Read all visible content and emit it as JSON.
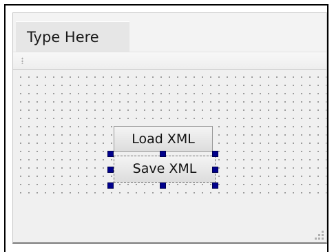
{
  "menubar": {
    "type_here_label": "Type Here"
  },
  "canvas": {
    "buttons": [
      {
        "label": "Load XML",
        "selected": false
      },
      {
        "label": "Save XML",
        "selected": true
      }
    ]
  },
  "colors": {
    "selection_handle": "#00008b",
    "window_background": "#f0f0f0",
    "grid_dot": "#8c8c8c"
  },
  "icons": {
    "toolbar_handle": "toolbar-grip-icon",
    "resize_grip": "resize-grip-icon"
  }
}
